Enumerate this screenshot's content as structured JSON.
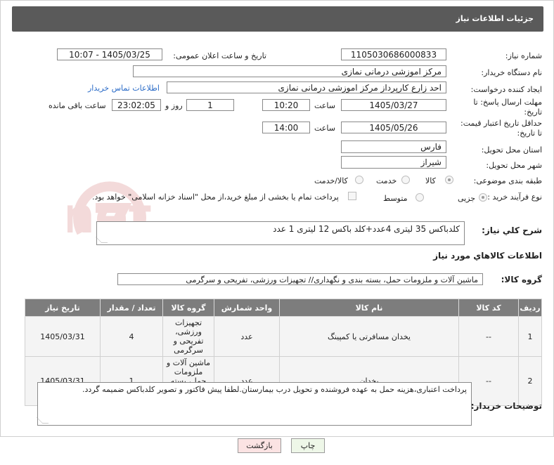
{
  "header": {
    "title": "جزئیات اطلاعات نیاز"
  },
  "fields": {
    "need_number_label": "شماره نیاز:",
    "need_number": "1105030686000833",
    "announce_label": "تاریخ و ساعت اعلان عمومی:",
    "announce_value": "1405/03/25 - 10:07",
    "buyer_org_label": "نام دستگاه خریدار:",
    "buyer_org": "مرکز اموزشی درمانی نمازی",
    "creator_label": "ایجاد کننده درخواست:",
    "creator": "احد زارع کارپرداز مرکز اموزشی درمانی نمازی",
    "contact_link": "اطلاعات تماس خریدار",
    "deadline_label_1": "مهلت ارسال پاسخ: تا",
    "deadline_label_2": "تاریخ:",
    "deadline_date": "1405/03/27",
    "time_label": "ساعت",
    "deadline_time": "10:20",
    "days": "1",
    "days_label": "روز و",
    "remaining": "23:02:05",
    "remaining_label": "ساعت باقی مانده",
    "validity_label_1": "حداقل تاریخ اعتبار قیمت:",
    "validity_label_2": "تا تاریخ:",
    "validity_date": "1405/05/26",
    "validity_time": "14:00",
    "province_label": "استان محل تحویل:",
    "province": "فارس",
    "city_label": "شهر محل تحویل:",
    "city": "شیراز",
    "category_label": "طبقه بندی موضوعی:",
    "category_options": [
      "کالا",
      "خدمت",
      "کالا/خدمت"
    ],
    "process_label": "نوع فرآیند خرید :",
    "process_options": [
      "جزیی",
      "متوسط"
    ],
    "payment_note": "پرداخت تمام یا بخشی از مبلغ خرید،از محل \"اسناد خزانه اسلامی\" خواهد بود."
  },
  "summary": {
    "label": "شرح کلي نياز:",
    "text": "کلدباکس 35 لیتری 4عدد+کلد باکس 12 لیتری 1 عدد"
  },
  "goods_info": {
    "title": "اطلاعات کالاهاي مورد نياز",
    "group_label": "گروه کالا:",
    "group_value": "ماشین آلات و ملزومات حمل، بسته بندی و نگهداری// تجهیزات ورزشی، تفریحی و سرگرمی"
  },
  "table": {
    "headers": [
      "رديف",
      "کد کالا",
      "نام کالا",
      "واحد شمارش",
      "گروه کالا",
      "تعداد / مقدار",
      "تاریخ نیاز"
    ],
    "rows": [
      [
        "1",
        "--",
        "یخدان مسافرتی یا کمپینگ",
        "عدد",
        "تجهیزات ورزشی، تفریحی و سرگرمی",
        "4",
        "1405/03/31"
      ],
      [
        "2",
        "--",
        "یخدان",
        "عدد",
        "ماشین آلات و ملزومات حمل، بسته بندی و نگهداری",
        "1",
        "1405/03/31"
      ]
    ]
  },
  "buyer_notes": {
    "label": "توضیحات خریدار:",
    "text": "پرداخت اعتباری،هزینه حمل به عهده فروشنده و تحویل درب بیمارستان.لطفا پیش فاکتور و تصویر کلدباکس ضمیمه گردد."
  },
  "buttons": {
    "print": "چاپ",
    "back": "بازگشت"
  },
  "watermark": {
    "text": "AriaTender.net"
  },
  "colors": {
    "header_bg": "#5a5a5a",
    "table_header_bg": "#7d7d7d",
    "link": "#2a6bc7",
    "print_btn": "#eef7e8",
    "back_btn": "#fbe3e3"
  }
}
